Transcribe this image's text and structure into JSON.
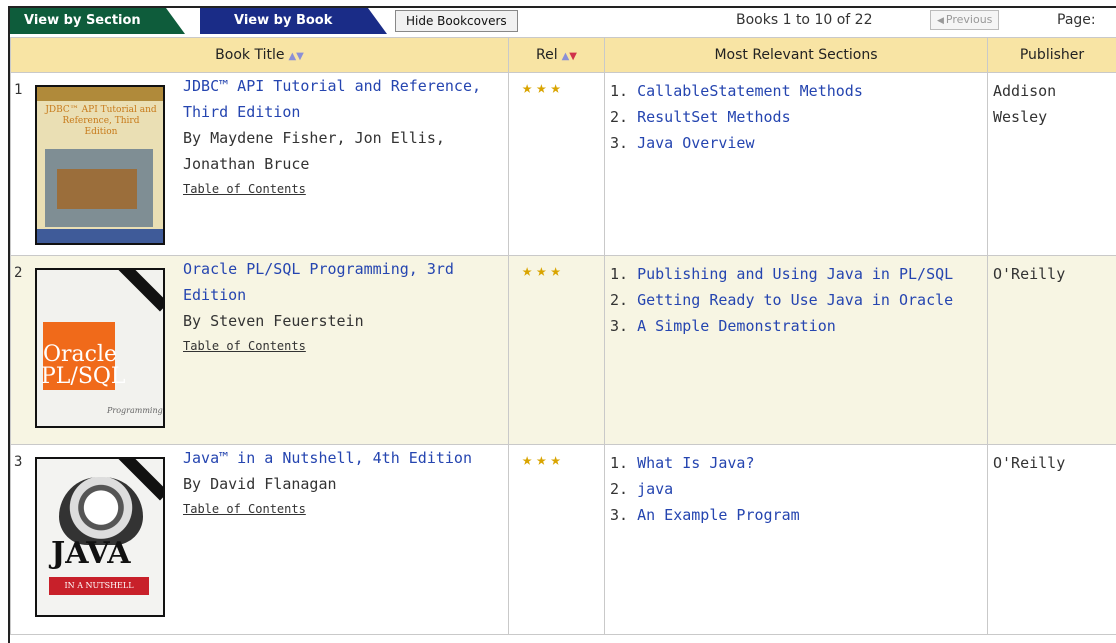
{
  "tabs": {
    "section": "View by Section",
    "book": "View by Book",
    "hide_bookcovers": "Hide Bookcovers"
  },
  "pagination": {
    "books_count": "Books 1 to 10 of 22",
    "previous": "Previous",
    "page_label": "Page:"
  },
  "table": {
    "headers": {
      "book_title": "Book Title",
      "relevance": "Rel",
      "sections": "Most Relevant Sections",
      "publisher": "Publisher"
    },
    "rows": [
      {
        "num": "1",
        "title": "JDBC™ API Tutorial and Reference, Third Edition",
        "by": "By Maydene Fisher, Jon Ellis, Jonathan Bruce",
        "toc": "Table of Contents",
        "stars": "★★★",
        "sections": [
          {
            "num": "1.",
            "label": "CallableStatement Methods"
          },
          {
            "num": "2.",
            "label": "ResultSet Methods"
          },
          {
            "num": "3.",
            "label": "Java Overview"
          }
        ],
        "publisher": "Addison Wesley",
        "cover_text": "JDBC™ API Tutorial and Reference, Third Edition"
      },
      {
        "num": "2",
        "title": "Oracle PL/SQL Programming, 3rd Edition",
        "by": "By Steven Feuerstein",
        "toc": "Table of Contents",
        "stars": "★★★",
        "sections": [
          {
            "num": "1.",
            "label": "Publishing and Using Java in PL/SQL"
          },
          {
            "num": "2.",
            "label": "Getting Ready to Use Java in Oracle"
          },
          {
            "num": "3.",
            "label": "A Simple Demonstration"
          }
        ],
        "publisher": "O'Reilly",
        "cover_text_1": "Oracle",
        "cover_text_2": "PL/SQL",
        "cover_text_3": "Programming"
      },
      {
        "num": "3",
        "title": "Java™ in a Nutshell, 4th Edition",
        "by": "By David Flanagan",
        "toc": "Table of Contents",
        "stars": "★★★",
        "sections": [
          {
            "num": "1.",
            "label": "What Is Java?"
          },
          {
            "num": "2.",
            "label": "java"
          },
          {
            "num": "3.",
            "label": "An Example Program"
          }
        ],
        "publisher": "O'Reilly",
        "cover_text_1": "JAVA",
        "cover_text_2": "IN A NUTSHELL"
      }
    ]
  },
  "colors": {
    "tab_section": "#0e5c3b",
    "tab_book": "#1a2c87",
    "header_bg": "#f8e4a4",
    "link": "#2545b0",
    "star": "#d9a400",
    "row_alt": "#f7f5e3"
  }
}
